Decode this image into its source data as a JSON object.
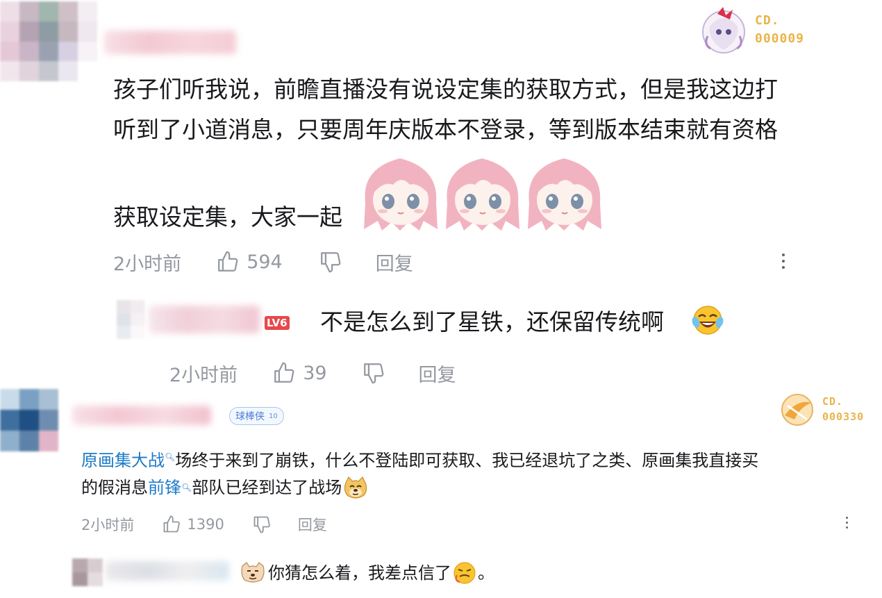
{
  "comment1": {
    "medal": {
      "line1": "CD.",
      "line2": "000009"
    },
    "text_line1": "孩子们听我说，前瞻直播没有说设定集的获取方式，但是我这边打",
    "text_line2": "听到了小道消息，只要周年庆版本不登录，等到版本结束就有资格",
    "text_line3": "获取设定集，大家一起",
    "time": "2小时前",
    "likes": "594",
    "reply_label": "回复",
    "emoji": "pink-haired-girl-sticker"
  },
  "reply1": {
    "level_badge": "LV6",
    "text": "不是怎么到了星铁，还保留传统啊",
    "emoji": "laughing-crying-emoji",
    "time": "2小时前",
    "likes": "39",
    "reply_label": "回复"
  },
  "comment2": {
    "fan_badge": {
      "label": "球棒侠",
      "level": "10"
    },
    "medal": {
      "line1": "CD.",
      "line2": "000330"
    },
    "link1": "原画集大战",
    "seg1": "场终于来到了崩铁，什么不登陆即可获取、我已经退坑了之类、原画集我直接买",
    "seg2": "的假消息",
    "link2": "前锋",
    "seg3": "部队已经到达了战场",
    "time": "2小时前",
    "likes": "1390",
    "reply_label": "回复"
  },
  "reply2": {
    "text": "你猜怎么着，我差点信了",
    "end": "。"
  },
  "colors": {
    "link": "#1e7bc8",
    "meta": "#9499a0",
    "medal_gold": "#e9b44a",
    "level_red": "#e8484b"
  }
}
